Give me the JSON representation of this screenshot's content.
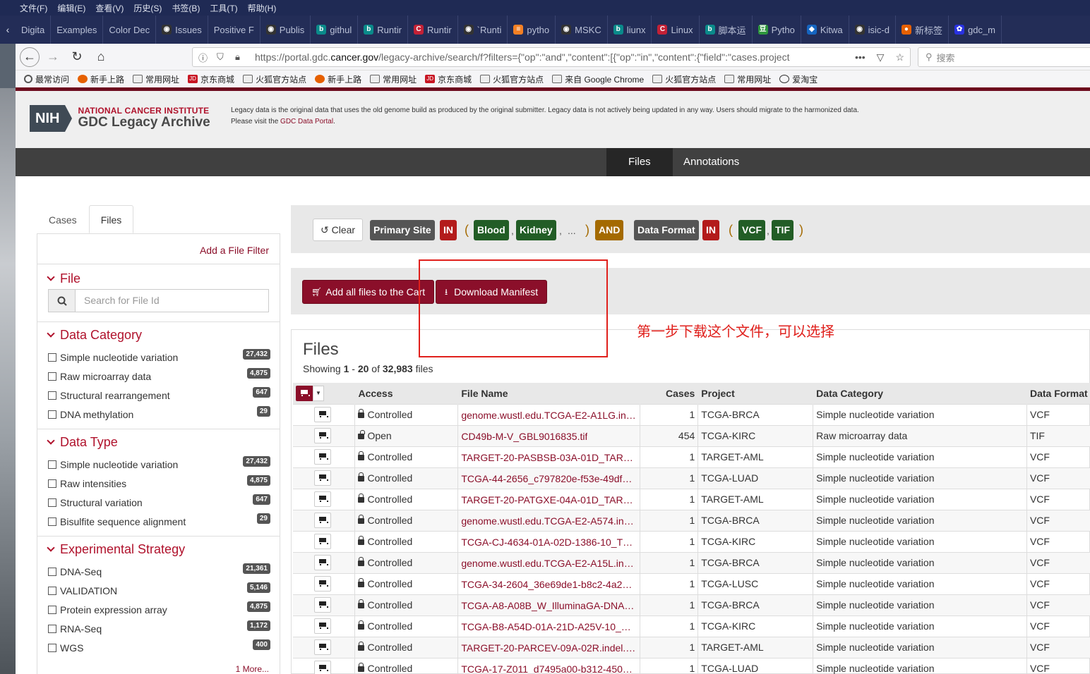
{
  "browser": {
    "menu": [
      "文件(F)",
      "编辑(E)",
      "查看(V)",
      "历史(S)",
      "书签(B)",
      "工具(T)",
      "帮助(H)"
    ],
    "tabs": [
      {
        "label": "Digita",
        "icon": "none"
      },
      {
        "label": "Examples",
        "icon": "none"
      },
      {
        "label": "Color Dec",
        "icon": "none"
      },
      {
        "label": "Issues",
        "icon": "github-icon"
      },
      {
        "label": "Positive F",
        "icon": "none"
      },
      {
        "label": "Publis",
        "icon": "github-icon"
      },
      {
        "label": "githul",
        "icon": "bing-icon"
      },
      {
        "label": "Runtir",
        "icon": "bing-icon"
      },
      {
        "label": "Runtir",
        "icon": "csdn-icon"
      },
      {
        "label": "`Runti",
        "icon": "github-icon"
      },
      {
        "label": "pytho",
        "icon": "stackoverflow-icon"
      },
      {
        "label": "MSKC",
        "icon": "github-icon"
      },
      {
        "label": "liunx",
        "icon": "bing-icon"
      },
      {
        "label": "Linux",
        "icon": "csdn-icon"
      },
      {
        "label": "脚本运",
        "icon": "bing-icon"
      },
      {
        "label": "Pytho",
        "icon": "douban-icon"
      },
      {
        "label": "Kitwa",
        "icon": "kitware-icon"
      },
      {
        "label": "isic-d",
        "icon": "github-icon"
      },
      {
        "label": "新标签",
        "icon": "firefox-icon"
      },
      {
        "label": "gdc_m",
        "icon": "baidu-icon"
      }
    ],
    "url_pre": "https://portal.gdc.",
    "url_domain": "cancer.gov",
    "url_post": "/legacy-archive/search/f?filters={\"op\":\"and\",\"content\":[{\"op\":\"in\",\"content\":{\"field\":\"cases.project",
    "search_placeholder": "搜索",
    "bookmarks": [
      {
        "label": "最常访问",
        "icon": "gear"
      },
      {
        "label": "新手上路",
        "icon": "fox"
      },
      {
        "label": "常用网址",
        "icon": "folder"
      },
      {
        "label": "京东商城",
        "icon": "jd"
      },
      {
        "label": "火狐官方站点",
        "icon": "folder"
      },
      {
        "label": "新手上路",
        "icon": "fox"
      },
      {
        "label": "常用网址",
        "icon": "folder"
      },
      {
        "label": "京东商城",
        "icon": "jd"
      },
      {
        "label": "火狐官方站点",
        "icon": "folder"
      },
      {
        "label": "来自 Google Chrome",
        "icon": "folder"
      },
      {
        "label": "火狐官方站点",
        "icon": "folder"
      },
      {
        "label": "常用网址",
        "icon": "folder"
      },
      {
        "label": "爱淘宝",
        "icon": "globe"
      }
    ]
  },
  "header": {
    "nih": "NIH",
    "institute": "NATIONAL CANCER INSTITUTE",
    "archive": "GDC Legacy Archive",
    "notice_line1": "Legacy data is the original data that uses the old genome build as produced by the original submitter. Legacy data is not actively being updated in any way. Users should migrate to the harmonized data.",
    "notice_pre": "Please visit the ",
    "notice_link": "GDC Data Portal",
    "notice_post": "."
  },
  "nav": {
    "files": "Files",
    "annotations": "Annotations"
  },
  "sidebar": {
    "tabs": [
      "Cases",
      "Files"
    ],
    "add_filter": "Add a File Filter",
    "file_title": "File",
    "file_search_placeholder": "Search for File Id",
    "sections": [
      {
        "title": "Data Category",
        "items": [
          {
            "label": "Simple nucleotide variation",
            "count": "27,432"
          },
          {
            "label": "Raw microarray data",
            "count": "4,875"
          },
          {
            "label": "Structural rearrangement",
            "count": "647"
          },
          {
            "label": "DNA methylation",
            "count": "29"
          }
        ]
      },
      {
        "title": "Data Type",
        "items": [
          {
            "label": "Simple nucleotide variation",
            "count": "27,432"
          },
          {
            "label": "Raw intensities",
            "count": "4,875"
          },
          {
            "label": "Structural variation",
            "count": "647"
          },
          {
            "label": "Bisulfite sequence alignment",
            "count": "29"
          }
        ]
      },
      {
        "title": "Experimental Strategy",
        "items": [
          {
            "label": "DNA-Seq",
            "count": "21,361"
          },
          {
            "label": "VALIDATION",
            "count": "5,146"
          },
          {
            "label": "Protein expression array",
            "count": "4,875"
          },
          {
            "label": "RNA-Seq",
            "count": "1,172"
          },
          {
            "label": "WGS",
            "count": "400"
          }
        ],
        "more": "1 More..."
      }
    ]
  },
  "query": {
    "clear": "Clear",
    "primary_site": "Primary Site",
    "in1": "IN",
    "blood": "Blood",
    "kidney": "Kidney",
    "ellipsis": "...",
    "and": "AND",
    "data_format": "Data Format",
    "in2": "IN",
    "vcf": "VCF",
    "tif": "TIF"
  },
  "actions": {
    "add_all": "Add all files to the Cart",
    "download": "Download Manifest"
  },
  "annotation_text": "第一步下载这个文件，可以选择",
  "files": {
    "title": "Files",
    "showing_pre": "Showing ",
    "from": "1",
    "to": "20",
    "of_word": " of ",
    "total": "32,983",
    "unit": " files",
    "columns": [
      "Access",
      "File Name",
      "Cases",
      "Project",
      "Data Category",
      "Data Format"
    ],
    "rows": [
      {
        "access": "Controlled",
        "name": "genome.wustl.edu.TCGA-E2-A1LG.in…",
        "cases": "1",
        "project": "TCGA-BRCA",
        "category": "Simple nucleotide variation",
        "format": "VCF"
      },
      {
        "access": "Open",
        "name": "CD49b-M-V_GBL9016835.tif",
        "cases": "454",
        "project": "TCGA-KIRC",
        "category": "Raw microarray data",
        "format": "TIF"
      },
      {
        "access": "Controlled",
        "name": "TARGET-20-PASBSB-03A-01D_TAR…",
        "cases": "1",
        "project": "TARGET-AML",
        "category": "Simple nucleotide variation",
        "format": "VCF"
      },
      {
        "access": "Controlled",
        "name": "TCGA-44-2656_c797820e-f53e-49df…",
        "cases": "1",
        "project": "TCGA-LUAD",
        "category": "Simple nucleotide variation",
        "format": "VCF"
      },
      {
        "access": "Controlled",
        "name": "TARGET-20-PATGXE-04A-01D_TAR…",
        "cases": "1",
        "project": "TARGET-AML",
        "category": "Simple nucleotide variation",
        "format": "VCF"
      },
      {
        "access": "Controlled",
        "name": "genome.wustl.edu.TCGA-E2-A574.in…",
        "cases": "1",
        "project": "TCGA-BRCA",
        "category": "Simple nucleotide variation",
        "format": "VCF"
      },
      {
        "access": "Controlled",
        "name": "TCGA-CJ-4634-01A-02D-1386-10_T…",
        "cases": "1",
        "project": "TCGA-KIRC",
        "category": "Simple nucleotide variation",
        "format": "VCF"
      },
      {
        "access": "Controlled",
        "name": "genome.wustl.edu.TCGA-E2-A15L.in…",
        "cases": "1",
        "project": "TCGA-BRCA",
        "category": "Simple nucleotide variation",
        "format": "VCF"
      },
      {
        "access": "Controlled",
        "name": "TCGA-34-2604_36e69de1-b8c2-4a2…",
        "cases": "1",
        "project": "TCGA-LUSC",
        "category": "Simple nucleotide variation",
        "format": "VCF"
      },
      {
        "access": "Controlled",
        "name": "TCGA-A8-A08B_W_IlluminaGA-DNA…",
        "cases": "1",
        "project": "TCGA-BRCA",
        "category": "Simple nucleotide variation",
        "format": "VCF"
      },
      {
        "access": "Controlled",
        "name": "TCGA-B8-A54D-01A-21D-A25V-10_…",
        "cases": "1",
        "project": "TCGA-KIRC",
        "category": "Simple nucleotide variation",
        "format": "VCF"
      },
      {
        "access": "Controlled",
        "name": "TARGET-20-PARCEV-09A-02R.indel.…",
        "cases": "1",
        "project": "TARGET-AML",
        "category": "Simple nucleotide variation",
        "format": "VCF"
      },
      {
        "access": "Controlled",
        "name": "TCGA-17-Z011_d7495a00-b312-450…",
        "cases": "1",
        "project": "TCGA-LUAD",
        "category": "Simple nucleotide variation",
        "format": "VCF"
      }
    ]
  },
  "colors": {
    "brand_maroon": "#8b0f2a",
    "nav_dark": "#404040",
    "annotation_red": "#e0201c",
    "chip_green": "#225d26",
    "chip_red": "#b31b1b",
    "chip_orange": "#a46a00"
  }
}
